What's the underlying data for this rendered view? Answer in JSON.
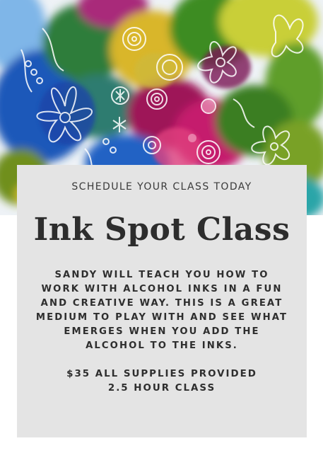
{
  "card": {
    "kicker": "SCHEDULE YOUR CLASS TODAY",
    "title": "Ink Spot Class",
    "description": "SANDY  WILL TEACH YOU HOW TO\nWORK WITH ALCOHOL INKS IN A FUN\nAND CREATIVE WAY.  THIS IS A GREAT\nMEDIUM TO PLAY WITH AND SEE WHAT\nEMERGES WHEN YOU ADD THE\nALCOHOL TO THE INKS.",
    "price": "$35 ALL SUPPLIES PROVIDED",
    "duration": "2.5 HOUR CLASS"
  },
  "colors": {
    "card_background": "#e4e4e4",
    "text": "#2e2e2e",
    "ink_blue": "#1f6fd1",
    "ink_green": "#4c8a24",
    "ink_magenta": "#c2146e",
    "ink_yellow": "#e2c325"
  }
}
